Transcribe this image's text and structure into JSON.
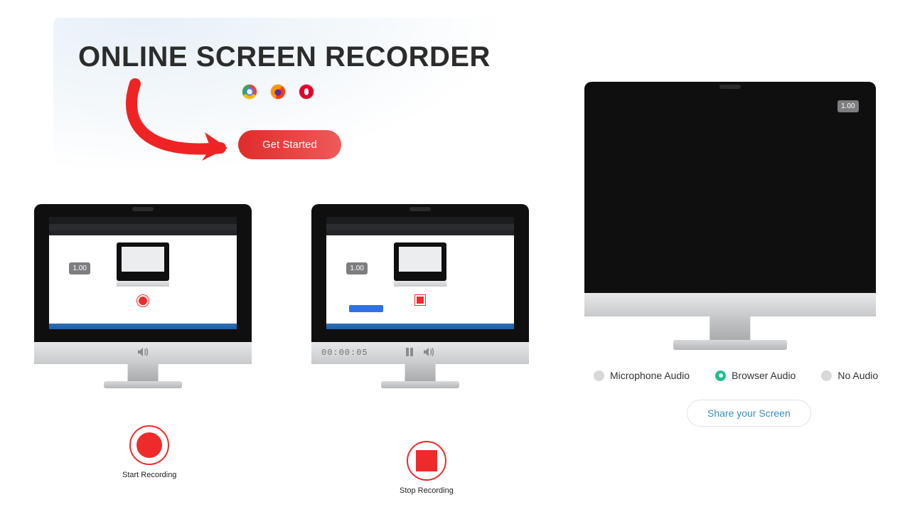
{
  "hero": {
    "title": "ONLINE SCREEN RECORDER",
    "get_started_label": "Get Started"
  },
  "browsers": [
    "chrome",
    "firefox",
    "opera"
  ],
  "monitor_left": {
    "zoom_label": "1.00",
    "chin_icons": [
      "sound"
    ]
  },
  "monitor_middle": {
    "zoom_label": "1.00",
    "timer": "00:00:05",
    "chin_icons": [
      "pause",
      "sound"
    ]
  },
  "monitor_right": {
    "zoom_label": "1.00"
  },
  "start_recording": {
    "label": "Start Recording"
  },
  "stop_recording": {
    "label": "Stop Recording"
  },
  "audio_options": [
    {
      "label": "Microphone Audio",
      "selected": false
    },
    {
      "label": "Browser Audio",
      "selected": true
    },
    {
      "label": "No Audio",
      "selected": false
    }
  ],
  "share_button_label": "Share your Screen",
  "colors": {
    "accent_red": "#ef2a2a",
    "accent_green": "#1cc18b",
    "link_blue": "#3a8ec2"
  }
}
